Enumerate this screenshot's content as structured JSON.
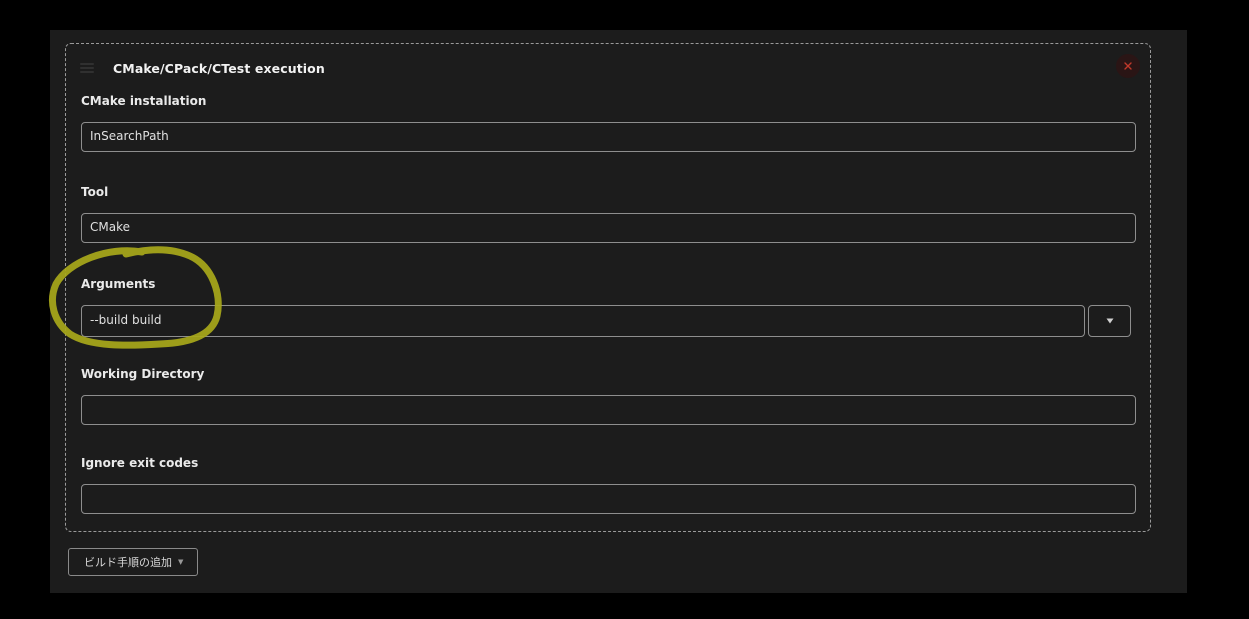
{
  "step": {
    "title": "CMake/CPack/CTest execution",
    "fields": {
      "cmake_installation": {
        "label": "CMake installation",
        "value": "InSearchPath"
      },
      "tool": {
        "label": "Tool",
        "value": "CMake"
      },
      "arguments": {
        "label": "Arguments",
        "value": "--build build"
      },
      "working_directory": {
        "label": "Working Directory",
        "value": ""
      },
      "ignore_exit_codes": {
        "label": "Ignore exit codes",
        "value": ""
      }
    }
  },
  "add_step_button": {
    "label": "ビルド手順の追加",
    "icon": "chevron-down-icon"
  },
  "colors": {
    "annotation": "#a8a81a",
    "close": "#c0392b"
  }
}
